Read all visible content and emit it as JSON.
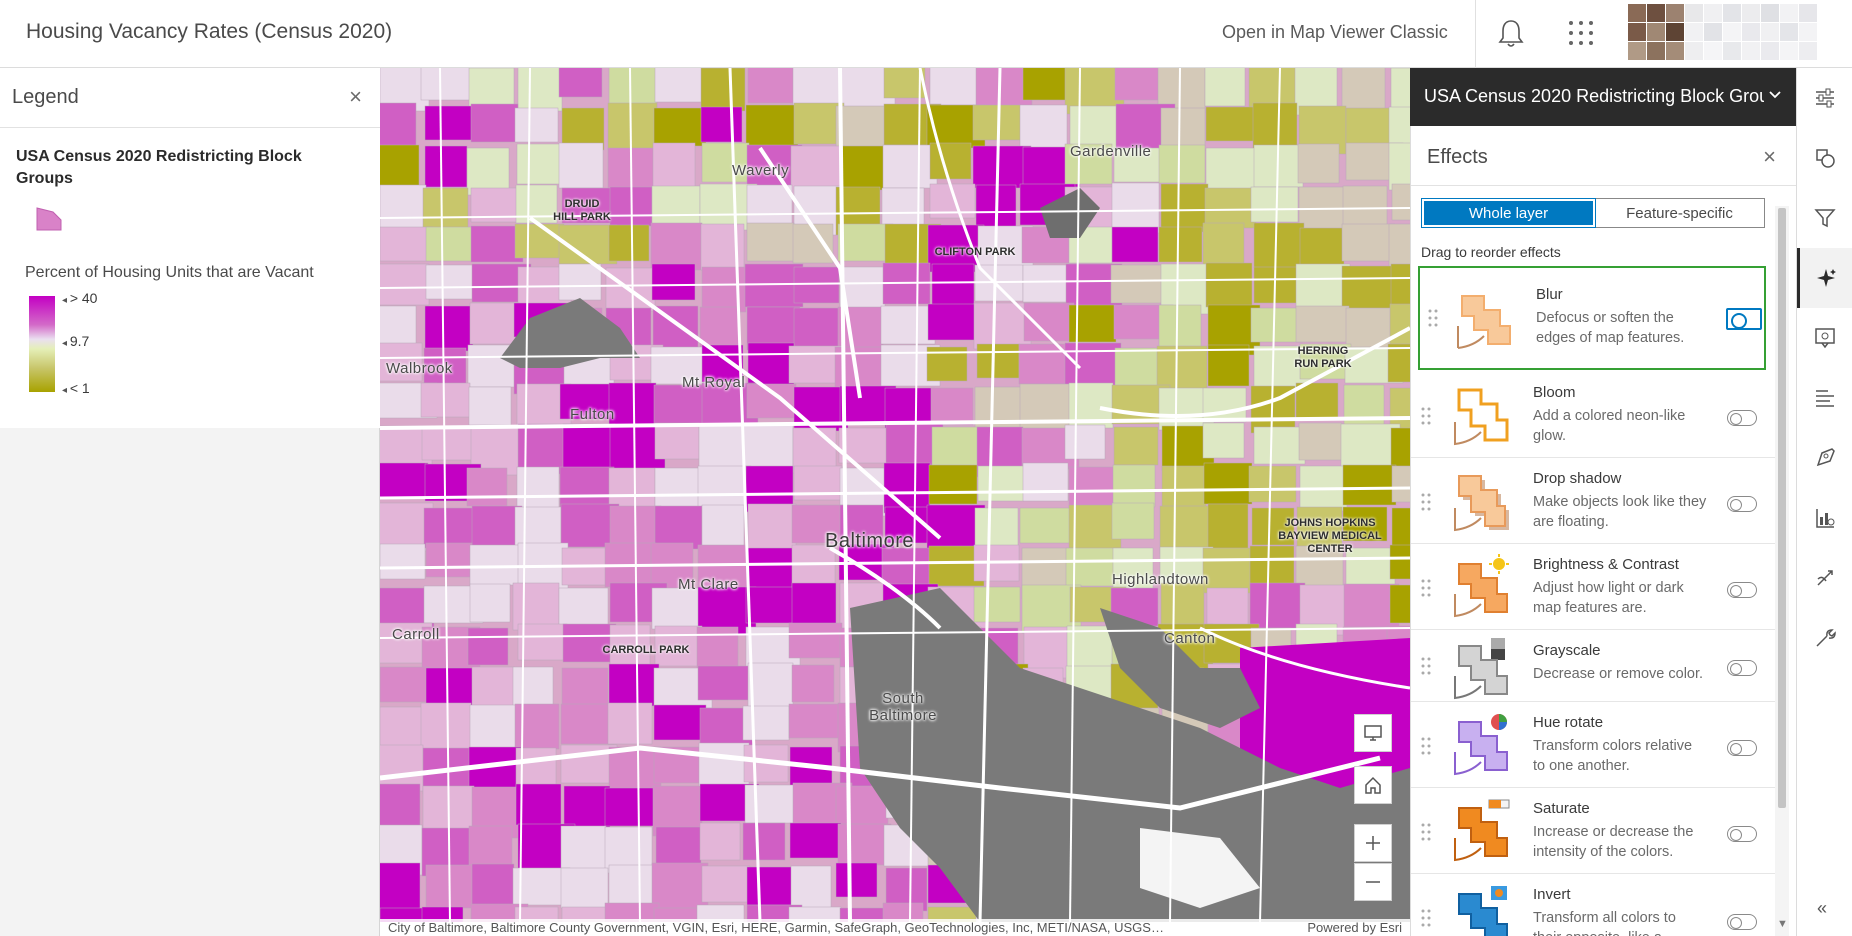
{
  "header": {
    "title": "Housing Vacancy Rates (Census 2020)",
    "open_classic": "Open in Map Viewer Classic",
    "icons": [
      "bell-icon",
      "apps-grid-icon",
      "user-avatar"
    ]
  },
  "legend": {
    "title": "Legend",
    "layer_name": "USA Census 2020 Redistricting Block Groups",
    "field_label": "Percent of Housing Units that are Vacant",
    "ramp_labels": {
      "high": "> 40",
      "mid": "9.7",
      "low": "< 1"
    },
    "ramp_colors": [
      "#c300c3",
      "#eadff0",
      "#a8a200"
    ]
  },
  "map": {
    "labels": {
      "waverly": "Waverly",
      "gardenville": "Gardenville",
      "druid_hill": "DRUID HILL PARK",
      "clifton": "CLIFTON PARK",
      "herring_run": "HERRING RUN PARK",
      "walbrook": "Walbrook",
      "mt_royal": "Mt Royal",
      "fulton": "Fulton",
      "baltimore": "Baltimore",
      "johns_hopkins": "JOHNS HOPKINS BAYVIEW MEDICAL CENTER",
      "mt_clare": "Mt Clare",
      "highlandtown": "Highlandtown",
      "carroll": "Carroll",
      "carroll_park": "CARROLL PARK",
      "canton": "Canton",
      "south_baltimore": "South Baltimore"
    },
    "attribution": "City of Baltimore, Baltimore County Government, VGIN, Esri, HERE, Garmin, SafeGraph, GeoTechnologies, Inc, METI/NASA, USGS…",
    "powered_by": "Powered by Esri",
    "buttons": [
      "screen-icon",
      "home-icon",
      "zoom-in-icon",
      "zoom-out-icon"
    ]
  },
  "layer_bar": {
    "label": "USA Census 2020 Redistricting Block Grou"
  },
  "effects": {
    "title": "Effects",
    "segments": {
      "whole": "Whole layer",
      "feature": "Feature-specific"
    },
    "drag_hint": "Drag to reorder effects",
    "items": [
      {
        "name": "Blur",
        "desc": "Defocus or soften the edges of map features.",
        "on": false
      },
      {
        "name": "Bloom",
        "desc": "Add a colored neon-like glow.",
        "on": false
      },
      {
        "name": "Drop shadow",
        "desc": "Make objects look like they are floating.",
        "on": false
      },
      {
        "name": "Brightness & Contrast",
        "desc": "Adjust how light or dark map features are.",
        "on": false
      },
      {
        "name": "Grayscale",
        "desc": "Decrease or remove color.",
        "on": false
      },
      {
        "name": "Hue rotate",
        "desc": "Transform colors relative to one another.",
        "on": false
      },
      {
        "name": "Saturate",
        "desc": "Increase or decrease the intensity of the colors.",
        "on": false
      },
      {
        "name": "Invert",
        "desc": "Transform all colors to their opposite, like a",
        "on": false
      }
    ]
  },
  "toolbar": {
    "tools": [
      "properties-icon",
      "styles-icon",
      "filter-icon",
      "effects-icon",
      "configure-popups-icon",
      "labels-icon",
      "sketch-icon",
      "fields-icon",
      "analysis-icon",
      "tools-icon"
    ],
    "active": "effects-icon"
  }
}
